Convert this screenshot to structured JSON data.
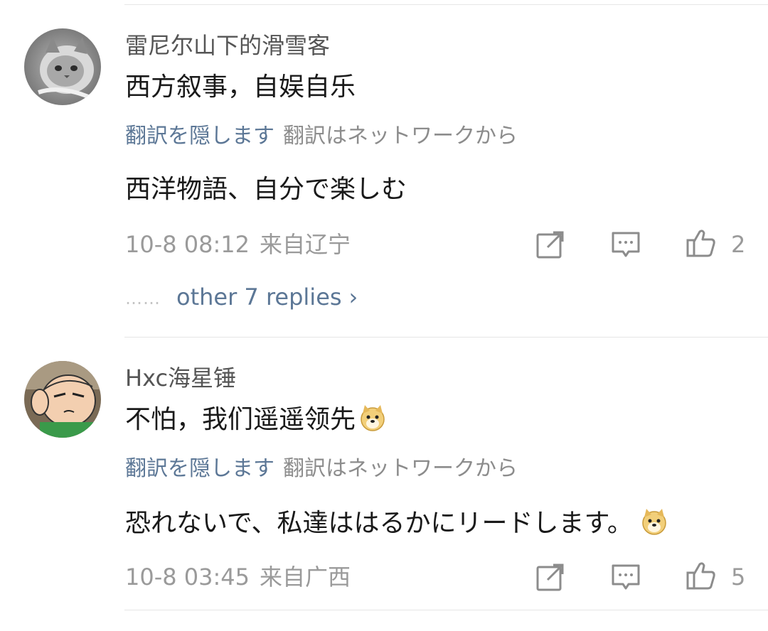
{
  "comments": [
    {
      "username": "雷尼尔山下的滑雪客",
      "text": "西方叙事，自娱自乐",
      "translate_hide": "翻訳を隠します",
      "translate_by": "翻訳はネットワークから",
      "translation": "西洋物語、自分で楽しむ",
      "timestamp": "10-8 08:12",
      "location": "来自辽宁",
      "likes": "2",
      "replies_dots": "……",
      "replies_label": "other 7 replies",
      "replies_chevron": "›"
    },
    {
      "username": "Hxc海星锤",
      "text": "不怕，我们遥遥领先",
      "translate_hide": "翻訳を隠します",
      "translate_by": "翻訳はネットワークから",
      "translation": "恐れないで、私達ははるかにリードします。",
      "timestamp": "10-8 03:45",
      "location": "来自广西",
      "likes": "5"
    }
  ],
  "icons": {
    "edit": "edit-icon",
    "comment": "comment-icon",
    "like": "thumbs-up-icon",
    "emoji": "doge-emoji-icon"
  },
  "colors": {
    "link": "#5c7796",
    "muted": "#9a9a9a",
    "text": "#1a1a1a"
  }
}
